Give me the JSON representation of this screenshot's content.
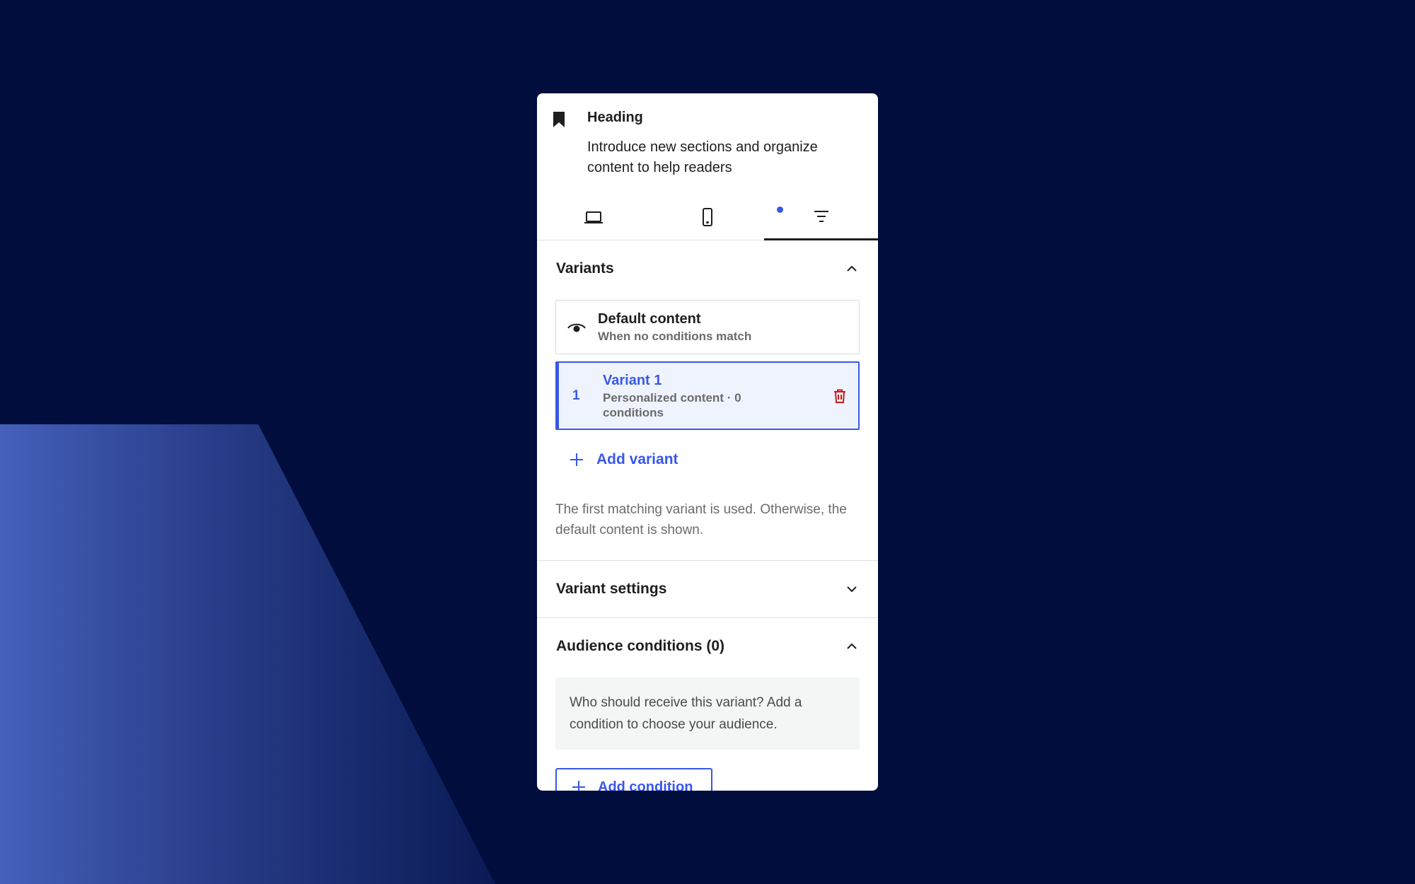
{
  "block": {
    "title": "Heading",
    "description": "Introduce new sections and organize content to help readers",
    "icon": "bookmark-icon"
  },
  "tabs": [
    {
      "name": "desktop",
      "icon": "laptop-icon",
      "active": false
    },
    {
      "name": "mobile",
      "icon": "mobile-icon",
      "active": false
    },
    {
      "name": "variants",
      "icon": "filter-icon",
      "active": true,
      "has_indicator": true
    }
  ],
  "variants_section": {
    "title": "Variants",
    "expanded": true,
    "default_row": {
      "title": "Default content",
      "subtitle": "When no conditions match",
      "icon": "eye-icon"
    },
    "variant_row": {
      "number": "1",
      "title": "Variant 1",
      "subtitle": "Personalized content · 0 conditions",
      "icon": "trash-icon"
    },
    "add_label": "Add variant",
    "help": "The first matching variant is used. Otherwise, the default content is shown."
  },
  "variant_settings": {
    "title": "Variant settings",
    "expanded": false
  },
  "audience": {
    "title": "Audience conditions (0)",
    "expanded": true,
    "callout": "Who should receive this variant? Add a condition to choose your audience.",
    "add_label": "Add condition"
  },
  "colors": {
    "background": "#000d3d",
    "accent": "#3858e9",
    "danger": "#cc1818"
  }
}
